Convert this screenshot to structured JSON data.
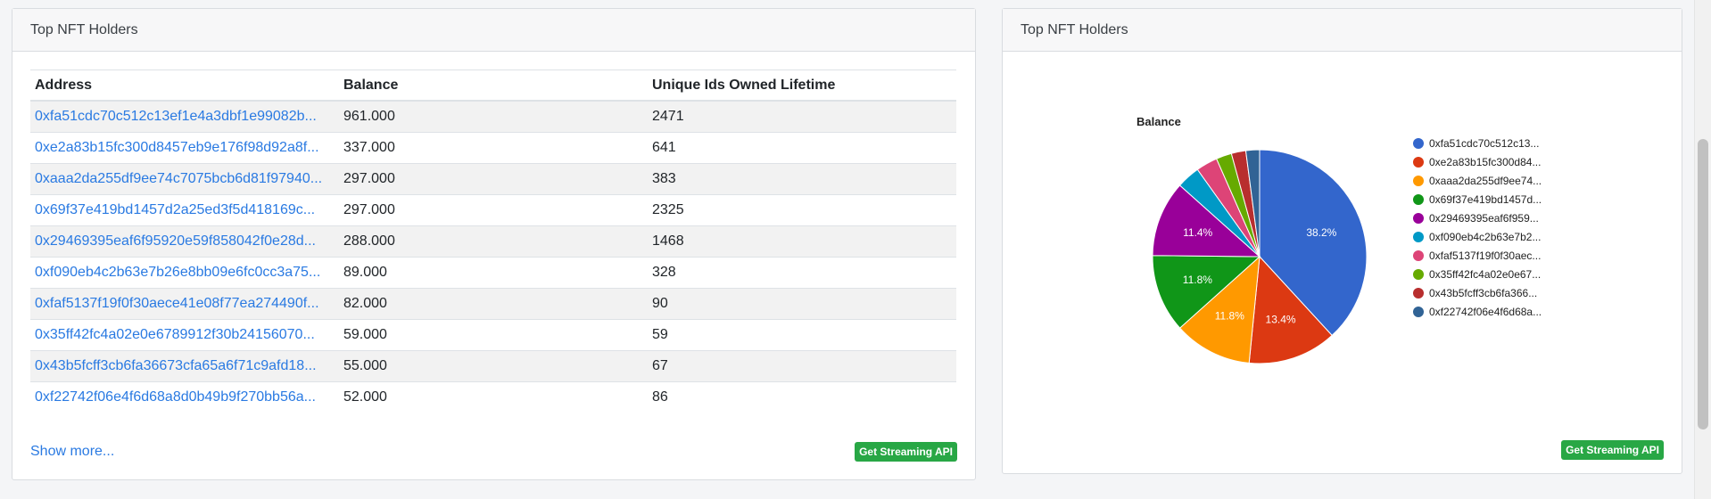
{
  "left_card": {
    "title": "Top NFT Holders",
    "columns": [
      "Address",
      "Balance",
      "Unique Ids Owned Lifetime"
    ],
    "rows": [
      {
        "address": "0xfa51cdc70c512c13ef1e4a3dbf1e99082b...",
        "balance": "961.000",
        "unique": "2471"
      },
      {
        "address": "0xe2a83b15fc300d8457eb9e176f98d92a8f...",
        "balance": "337.000",
        "unique": "641"
      },
      {
        "address": "0xaaa2da255df9ee74c7075bcb6d81f97940...",
        "balance": "297.000",
        "unique": "383"
      },
      {
        "address": "0x69f37e419bd1457d2a25ed3f5d418169c...",
        "balance": "297.000",
        "unique": "2325"
      },
      {
        "address": "0x29469395eaf6f95920e59f858042f0e28d...",
        "balance": "288.000",
        "unique": "1468"
      },
      {
        "address": "0xf090eb4c2b63e7b26e8bb09e6fc0cc3a75...",
        "balance": "89.000",
        "unique": "328"
      },
      {
        "address": "0xfaf5137f19f0f30aece41e08f77ea274490f...",
        "balance": "82.000",
        "unique": "90"
      },
      {
        "address": "0x35ff42fc4a02e0e6789912f30b24156070...",
        "balance": "59.000",
        "unique": "59"
      },
      {
        "address": "0x43b5fcff3cb6fa36673cfa65a6f71c9afd18...",
        "balance": "55.000",
        "unique": "67"
      },
      {
        "address": "0xf22742f06e4f6d68a8d0b49b9f270bb56a...",
        "balance": "52.000",
        "unique": "86"
      }
    ],
    "show_more": "Show more...",
    "api_button": "Get Streaming API"
  },
  "right_card": {
    "title": "Top NFT Holders",
    "api_button": "Get Streaming API"
  },
  "chart_data": {
    "type": "pie",
    "title": "Balance",
    "legend_position": "right",
    "categories": [
      "0xfa51cdc70c512c13...",
      "0xe2a83b15fc300d84...",
      "0xaaa2da255df9ee74...",
      "0x69f37e419bd1457d...",
      "0x29469395eaf6f959...",
      "0xf090eb4c2b63e7b2...",
      "0xfaf5137f19f0f30aec...",
      "0x35ff42fc4a02e0e67...",
      "0x43b5fcff3cb6fa366...",
      "0xf22742f06e4f6d68a..."
    ],
    "values": [
      961,
      337,
      297,
      297,
      288,
      89,
      82,
      59,
      55,
      52
    ],
    "slice_labels": [
      "38.2%",
      "13.4%",
      "11.8%",
      "11.8%",
      "11.4%",
      "",
      "",
      "",
      "",
      ""
    ],
    "colors": [
      "#3366cc",
      "#dc3912",
      "#ff9900",
      "#109618",
      "#990099",
      "#0099c6",
      "#dd4477",
      "#66aa00",
      "#b82e2e",
      "#316395"
    ]
  }
}
